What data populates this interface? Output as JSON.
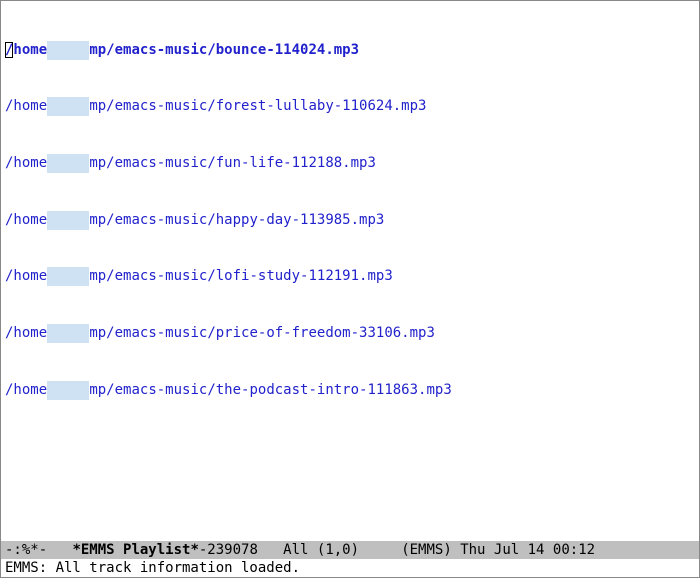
{
  "playlist": {
    "path_prefix": "/home",
    "path_redacted": "     ",
    "path_mid": "mp/emacs-music/",
    "tracks": [
      {
        "file": "bounce-114024.mp3",
        "current": true
      },
      {
        "file": "forest-lullaby-110624.mp3",
        "current": false
      },
      {
        "file": "fun-life-112188.mp3",
        "current": false
      },
      {
        "file": "happy-day-113985.mp3",
        "current": false
      },
      {
        "file": "lofi-study-112191.mp3",
        "current": false
      },
      {
        "file": "price-of-freedom-33106.mp3",
        "current": false
      },
      {
        "file": "the-podcast-intro-111863.mp3",
        "current": false
      }
    ]
  },
  "modeline": {
    "status": "-:%*-   ",
    "buffer_name": "*EMMS Playlist*",
    "buffer_suffix": "-239078",
    "position": "   All (1,0)     ",
    "mode": "(EMMS)",
    "datetime": " Thu Jul 14 00:12"
  },
  "minibuffer": {
    "message": "EMMS: All track information loaded."
  }
}
